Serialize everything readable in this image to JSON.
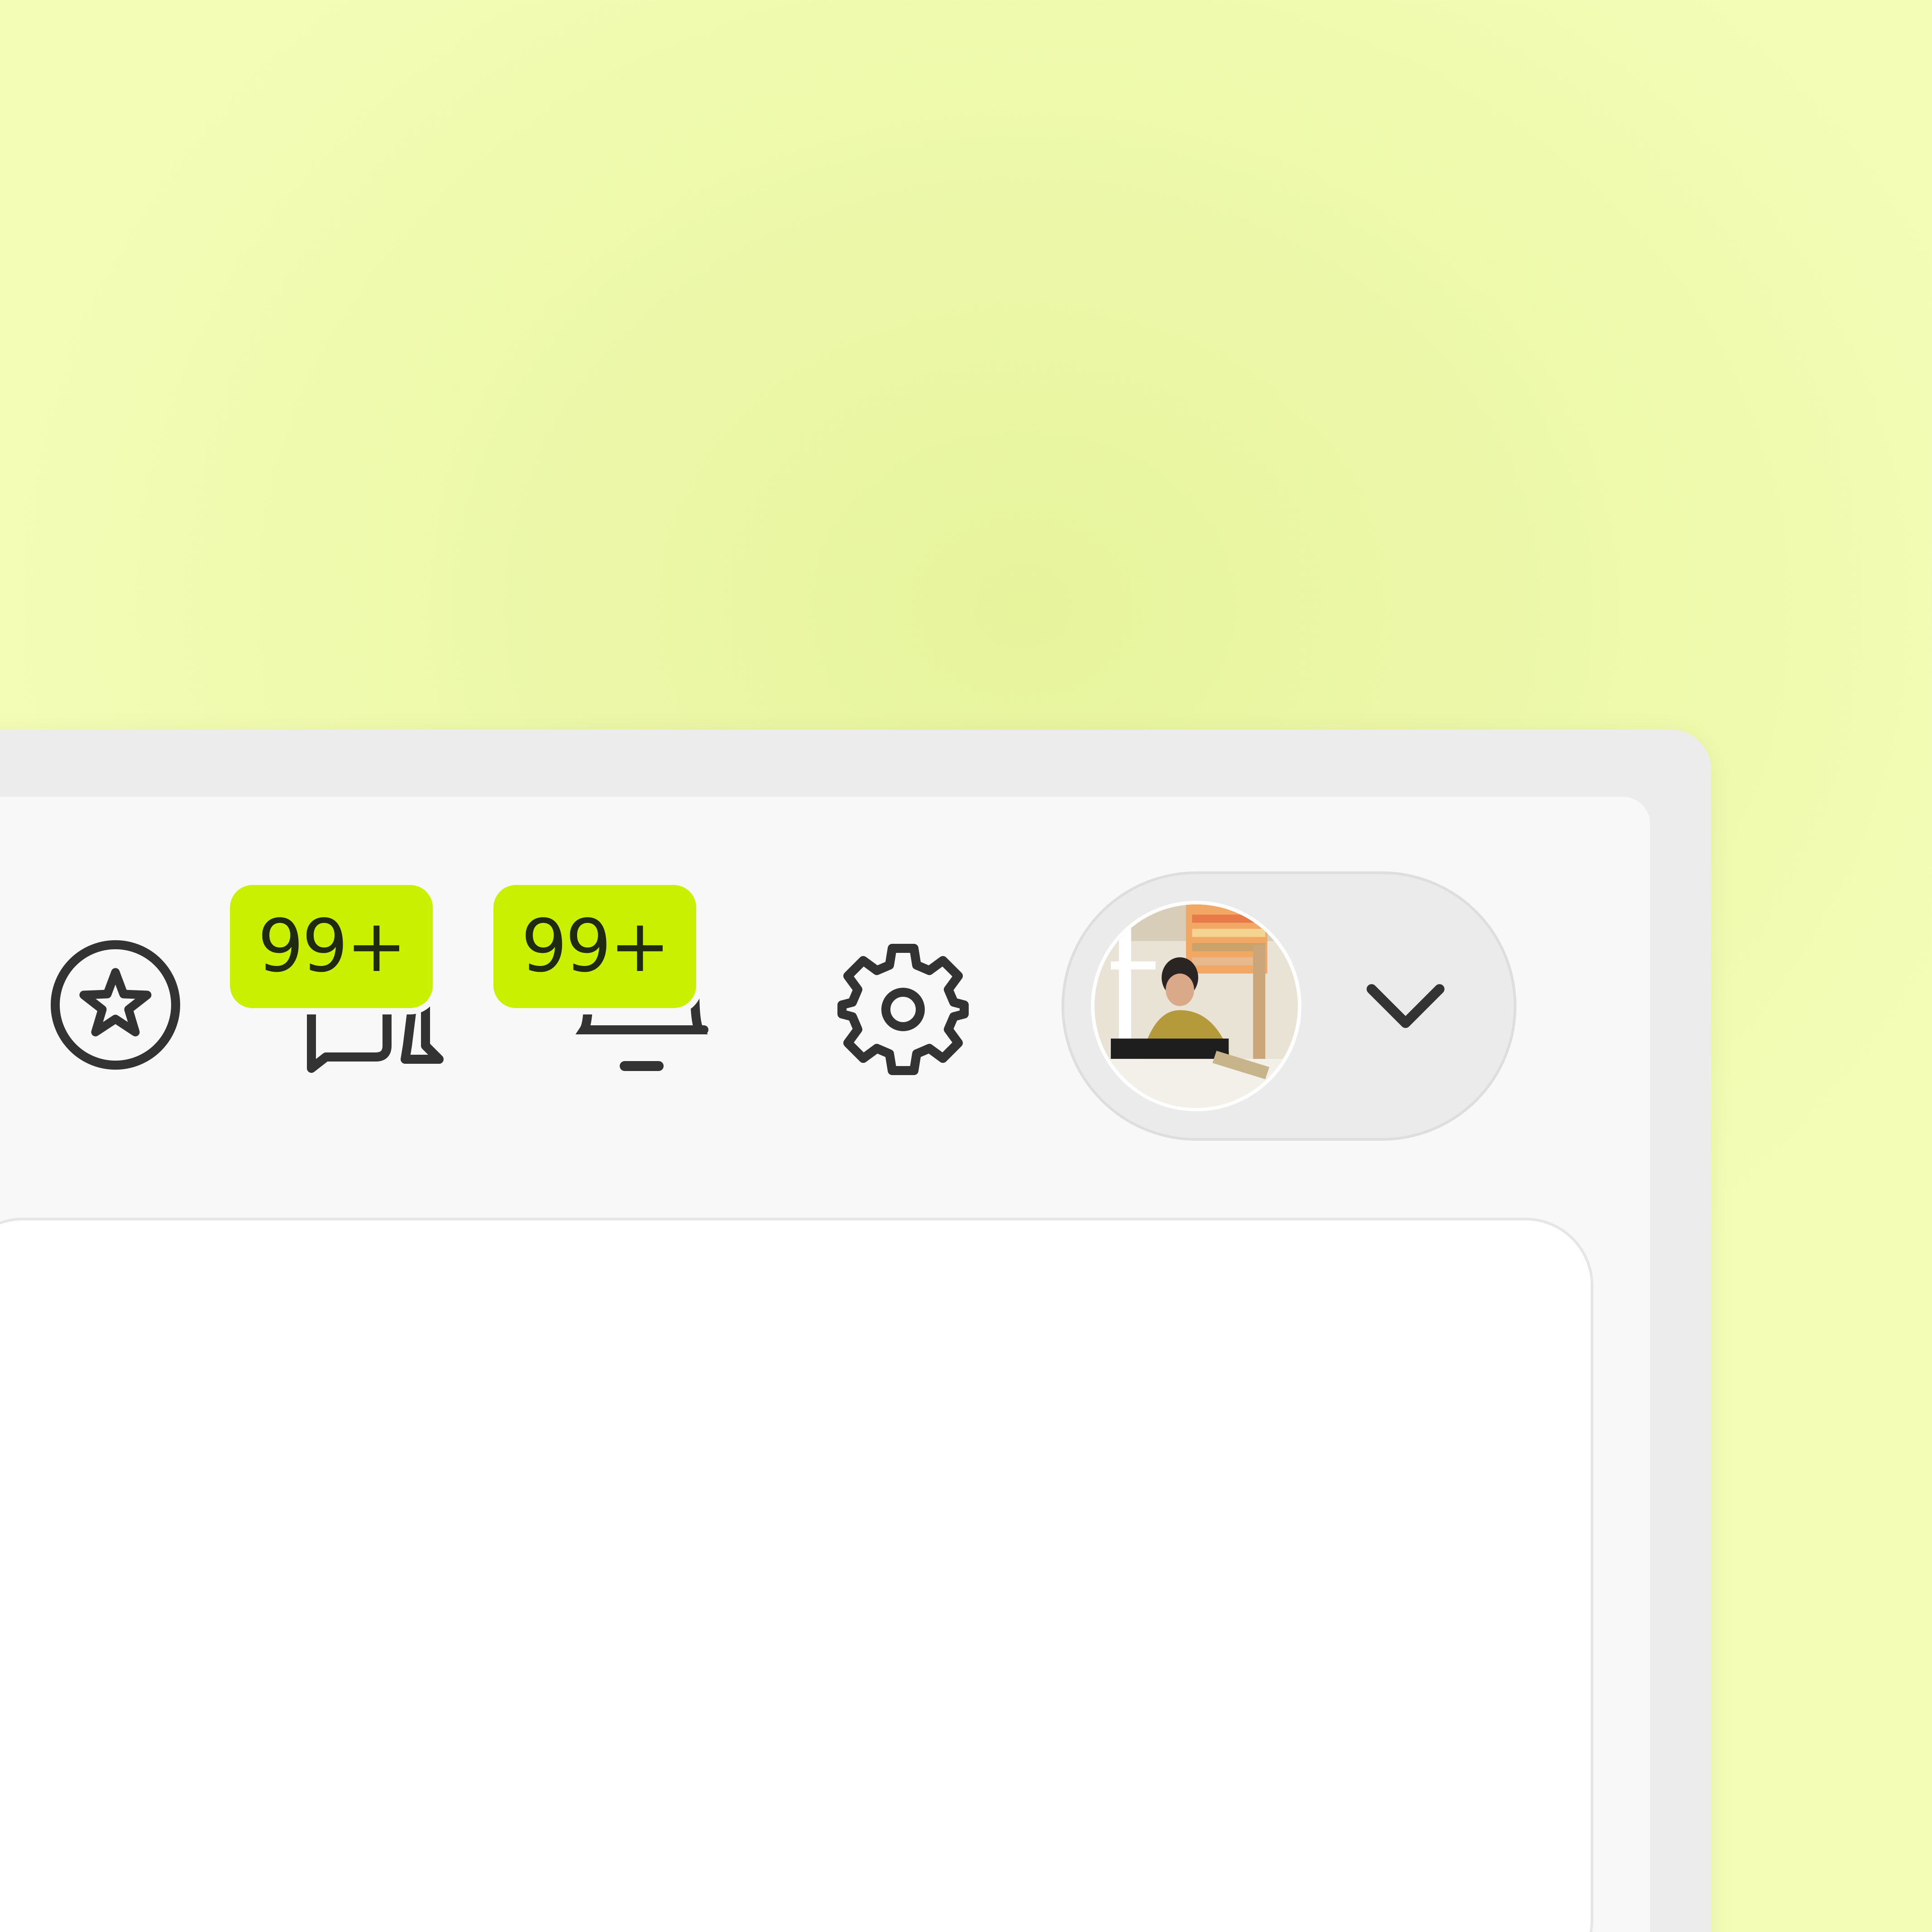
{
  "header": {
    "notifications": [
      {
        "badge": "99+",
        "icon": "chat-bubbles-icon"
      },
      {
        "badge": "99+",
        "icon": "bell-icon"
      }
    ],
    "icons": {
      "favorites": "star-circle-icon",
      "settings": "gear-icon",
      "menu": "chevron-down-icon"
    },
    "profile": {
      "avatar": "user-photo-avatar"
    }
  },
  "colors": {
    "badge_background": "#c8f000",
    "icon_stroke": "#333333",
    "page_background": "#ecf8a8"
  }
}
